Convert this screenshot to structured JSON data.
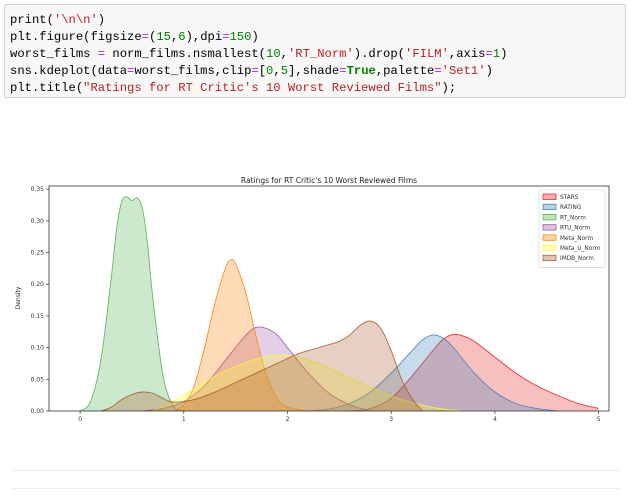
{
  "code_cell": {
    "lines": [
      [
        {
          "t": "print",
          "c": "fn"
        },
        {
          "t": "(",
          "c": "p"
        },
        {
          "t": "'\\n\\n'",
          "c": "str"
        },
        {
          "t": ")",
          "c": "p"
        }
      ],
      [
        {
          "t": "plt.figure(figsize",
          "c": "fn"
        },
        {
          "t": "=",
          "c": "op"
        },
        {
          "t": "(",
          "c": "p"
        },
        {
          "t": "15",
          "c": "num"
        },
        {
          "t": ",",
          "c": "p"
        },
        {
          "t": "6",
          "c": "num"
        },
        {
          "t": "),dpi",
          "c": "p"
        },
        {
          "t": "=",
          "c": "op"
        },
        {
          "t": "150",
          "c": "num"
        },
        {
          "t": ")",
          "c": "p"
        }
      ],
      [
        {
          "t": "worst_films ",
          "c": "fn"
        },
        {
          "t": "=",
          "c": "op"
        },
        {
          "t": " norm_films.nsmallest(",
          "c": "fn"
        },
        {
          "t": "10",
          "c": "num"
        },
        {
          "t": ",",
          "c": "p"
        },
        {
          "t": "'RT_Norm'",
          "c": "str"
        },
        {
          "t": ").drop(",
          "c": "p"
        },
        {
          "t": "'FILM'",
          "c": "str"
        },
        {
          "t": ",axis",
          "c": "p"
        },
        {
          "t": "=",
          "c": "op"
        },
        {
          "t": "1",
          "c": "num"
        },
        {
          "t": ")",
          "c": "p"
        }
      ],
      [
        {
          "t": "sns.kdeplot(data",
          "c": "fn"
        },
        {
          "t": "=",
          "c": "op"
        },
        {
          "t": "worst_films,clip",
          "c": "fn"
        },
        {
          "t": "=",
          "c": "op"
        },
        {
          "t": "[",
          "c": "p"
        },
        {
          "t": "0",
          "c": "num"
        },
        {
          "t": ",",
          "c": "p"
        },
        {
          "t": "5",
          "c": "num"
        },
        {
          "t": "],shade",
          "c": "p"
        },
        {
          "t": "=",
          "c": "op"
        },
        {
          "t": "True",
          "c": "kw"
        },
        {
          "t": ",palette",
          "c": "p"
        },
        {
          "t": "=",
          "c": "op"
        },
        {
          "t": "'Set1'",
          "c": "str"
        },
        {
          "t": ")",
          "c": "p"
        }
      ],
      [
        {
          "t": "plt.title(",
          "c": "fn"
        },
        {
          "t": "\"Ratings for RT Critic's 10 Worst Reviewed Films\"",
          "c": "str"
        },
        {
          "t": ");",
          "c": "p"
        }
      ]
    ]
  },
  "chart_data": {
    "type": "area",
    "title": "Ratings for RT Critic's 10 Worst Reviewed Films",
    "xlabel": "",
    "ylabel": "Density",
    "xlim": [
      -0.3,
      5.1
    ],
    "ylim": [
      0,
      0.355
    ],
    "xticks": [
      "0",
      "1",
      "2",
      "3",
      "4",
      "5"
    ],
    "yticks": [
      "0.00",
      "0.05",
      "0.10",
      "0.15",
      "0.20",
      "0.25",
      "0.30",
      "0.35"
    ],
    "legend_position": "top-right",
    "grid": false,
    "series": [
      {
        "name": "STARS",
        "color": "#e41a1c",
        "x": [
          2.6,
          2.8,
          3.0,
          3.2,
          3.4,
          3.5,
          3.6,
          3.7,
          3.8,
          4.0,
          4.2,
          4.4,
          4.6,
          4.8,
          5.0
        ],
        "y": [
          0.0,
          0.004,
          0.02,
          0.055,
          0.095,
          0.113,
          0.121,
          0.118,
          0.11,
          0.085,
          0.06,
          0.04,
          0.025,
          0.012,
          0.004
        ]
      },
      {
        "name": "RATING",
        "color": "#377eb8",
        "x": [
          2.2,
          2.4,
          2.6,
          2.8,
          3.0,
          3.2,
          3.3,
          3.4,
          3.5,
          3.6,
          3.8,
          4.0,
          4.2,
          4.4,
          4.6
        ],
        "y": [
          0.0,
          0.003,
          0.012,
          0.03,
          0.06,
          0.095,
          0.112,
          0.12,
          0.115,
          0.1,
          0.06,
          0.03,
          0.012,
          0.004,
          0.0
        ]
      },
      {
        "name": "RT_Norm",
        "color": "#4daf4a",
        "x": [
          0.0,
          0.1,
          0.2,
          0.3,
          0.35,
          0.4,
          0.45,
          0.5,
          0.55,
          0.6,
          0.65,
          0.7,
          0.8,
          0.9,
          1.0
        ],
        "y": [
          0.0,
          0.015,
          0.08,
          0.21,
          0.285,
          0.33,
          0.338,
          0.332,
          0.336,
          0.32,
          0.265,
          0.18,
          0.055,
          0.008,
          0.0
        ]
      },
      {
        "name": "RTU_Norm",
        "color": "#984ea3",
        "x": [
          0.6,
          0.8,
          1.0,
          1.2,
          1.4,
          1.6,
          1.7,
          1.8,
          1.9,
          2.0,
          2.2,
          2.4,
          2.6,
          2.8
        ],
        "y": [
          0.0,
          0.004,
          0.015,
          0.04,
          0.08,
          0.12,
          0.132,
          0.13,
          0.12,
          0.1,
          0.06,
          0.028,
          0.01,
          0.0
        ]
      },
      {
        "name": "Meta_Norm",
        "color": "#ff7f00",
        "x": [
          0.9,
          1.0,
          1.1,
          1.2,
          1.3,
          1.4,
          1.45,
          1.5,
          1.6,
          1.7,
          1.8,
          1.9,
          2.0,
          2.2
        ],
        "y": [
          0.0,
          0.01,
          0.04,
          0.1,
          0.17,
          0.225,
          0.238,
          0.232,
          0.185,
          0.115,
          0.055,
          0.02,
          0.006,
          0.0
        ]
      },
      {
        "name": "Meta_U_Norm",
        "color": "#ffff33",
        "x": [
          0.7,
          0.9,
          1.1,
          1.3,
          1.5,
          1.7,
          1.9,
          2.1,
          2.3,
          2.5,
          2.7,
          2.9,
          3.1,
          3.3,
          3.5,
          3.7
        ],
        "y": [
          0.0,
          0.015,
          0.035,
          0.055,
          0.07,
          0.082,
          0.088,
          0.085,
          0.075,
          0.06,
          0.045,
          0.03,
          0.018,
          0.009,
          0.003,
          0.0
        ]
      },
      {
        "name": "IMDB_Norm",
        "color": "#a65628",
        "x": [
          0.2,
          0.3,
          0.4,
          0.5,
          0.6,
          0.7,
          0.8,
          0.9,
          1.1,
          1.3,
          1.5,
          1.7,
          1.9,
          2.1,
          2.3,
          2.5,
          2.6,
          2.7,
          2.8,
          2.9,
          3.0,
          3.1,
          3.2,
          3.3
        ],
        "y": [
          0.0,
          0.006,
          0.018,
          0.026,
          0.03,
          0.028,
          0.02,
          0.014,
          0.018,
          0.03,
          0.045,
          0.06,
          0.075,
          0.09,
          0.1,
          0.11,
          0.12,
          0.135,
          0.142,
          0.13,
          0.095,
          0.05,
          0.02,
          0.0
        ]
      }
    ]
  }
}
